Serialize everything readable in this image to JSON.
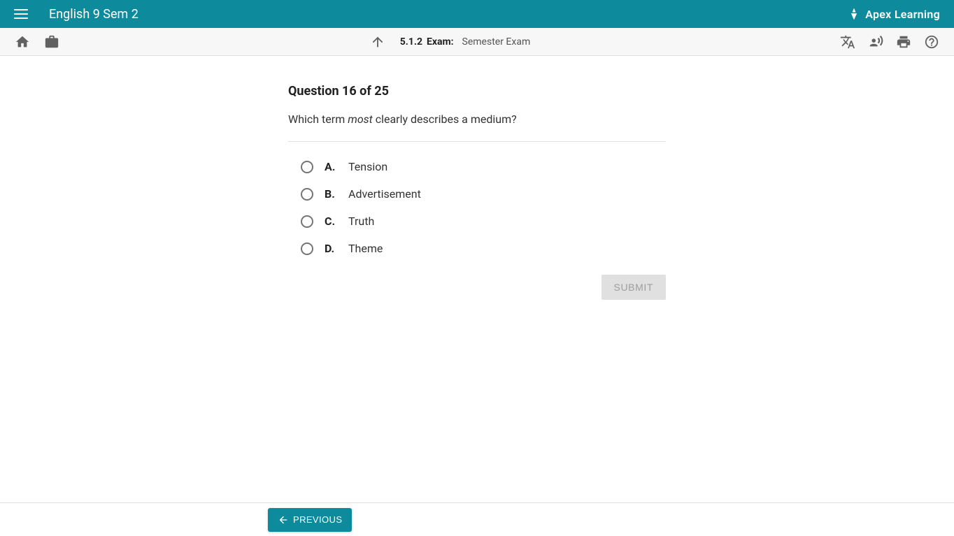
{
  "header": {
    "course_title": "English 9 Sem 2",
    "brand": "Apex Learning"
  },
  "subbar": {
    "number": "5.1.2",
    "label": "Exam:",
    "title": "Semester Exam"
  },
  "question": {
    "progress": "Question 16 of 25",
    "prompt_prefix": "Which term ",
    "prompt_em": "most",
    "prompt_suffix": " clearly describes a medium?",
    "answers": [
      {
        "letter": "A.",
        "text": "Tension"
      },
      {
        "letter": "B.",
        "text": "Advertisement"
      },
      {
        "letter": "C.",
        "text": "Truth"
      },
      {
        "letter": "D.",
        "text": "Theme"
      }
    ],
    "submit_label": "SUBMIT"
  },
  "footer": {
    "previous_label": "PREVIOUS"
  }
}
